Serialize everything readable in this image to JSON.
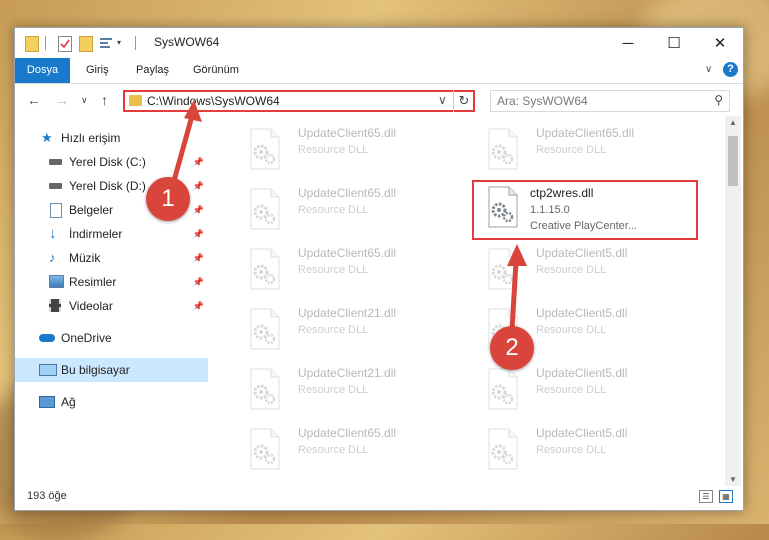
{
  "window": {
    "title": "SysWOW64"
  },
  "ribbon": {
    "tabs": [
      "Dosya",
      "Giriş",
      "Paylaş",
      "Görünüm"
    ]
  },
  "address": {
    "path": "C:\\Windows\\SysWOW64"
  },
  "search": {
    "placeholder": "Ara: SysWOW64"
  },
  "sidebar": {
    "items": [
      {
        "label": "Hızlı erişim",
        "icon": "star-icon",
        "pinned": false
      },
      {
        "label": "Yerel Disk (C:)",
        "icon": "drive-icon",
        "pinned": true
      },
      {
        "label": "Yerel Disk (D:)",
        "icon": "drive-icon",
        "pinned": true
      },
      {
        "label": "Belgeler",
        "icon": "document-icon",
        "pinned": true
      },
      {
        "label": "İndirmeler",
        "icon": "download-icon",
        "pinned": true
      },
      {
        "label": "Müzik",
        "icon": "music-icon",
        "pinned": true
      },
      {
        "label": "Resimler",
        "icon": "pictures-icon",
        "pinned": true
      },
      {
        "label": "Videolar",
        "icon": "video-icon",
        "pinned": true
      },
      {
        "label": "OneDrive",
        "icon": "cloud-icon",
        "pinned": false
      },
      {
        "label": "Bu bilgisayar",
        "icon": "computer-icon",
        "pinned": false
      },
      {
        "label": "Ağ",
        "icon": "network-icon",
        "pinned": false
      }
    ]
  },
  "files": {
    "left": [
      {
        "name": "UpdateClient65.dll",
        "desc": "Resource DLL"
      },
      {
        "name": "UpdateClient65.dll",
        "desc": "Resource DLL"
      },
      {
        "name": "UpdateClient65.dll",
        "desc": "Resource DLL"
      },
      {
        "name": "UpdateClient21.dll",
        "desc": "Resource DLL"
      },
      {
        "name": "UpdateClient21.dll",
        "desc": "Resource DLL"
      },
      {
        "name": "UpdateClient65.dll",
        "desc": "Resource DLL"
      }
    ],
    "right": [
      {
        "name": "UpdateClient65.dll",
        "desc": "Resource DLL"
      },
      {
        "name": "UpdateClient5.dll",
        "desc": "Resource DLL"
      },
      {
        "name": "UpdateClient5.dll",
        "desc": "Resource DLL"
      },
      {
        "name": "UpdateClient5.dll",
        "desc": "Resource DLL"
      },
      {
        "name": "UpdateClient5.dll",
        "desc": "Resource DLL"
      }
    ],
    "selected": {
      "name": "ctp2wres.dll",
      "version": "1.1.15.0",
      "desc": "Creative PlayCenter..."
    }
  },
  "status": {
    "count": "193 öğe"
  },
  "callouts": [
    "1",
    "2"
  ],
  "colors": {
    "accent": "#1979ca",
    "highlight": "#e53b3b",
    "badge": "#d9453b"
  }
}
